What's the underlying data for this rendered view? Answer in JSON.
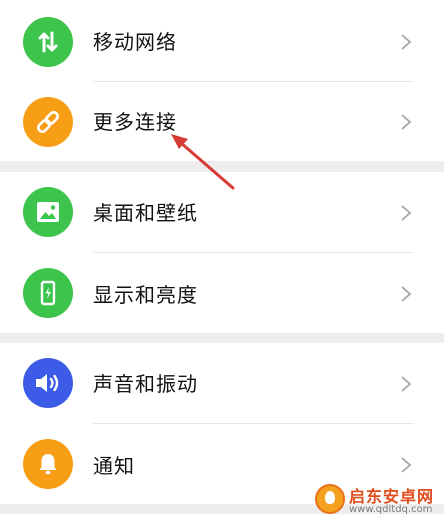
{
  "settings": {
    "items": [
      {
        "label": "移动网络",
        "icon": "data-transfer-icon",
        "color": "#3cc44c"
      },
      {
        "label": "更多连接",
        "icon": "link-icon",
        "color": "#f89e16"
      },
      {
        "label": "桌面和壁纸",
        "icon": "image-icon",
        "color": "#3cc44c"
      },
      {
        "label": "显示和亮度",
        "icon": "phone-brightness-icon",
        "color": "#3cc44c"
      },
      {
        "label": "声音和振动",
        "icon": "speaker-icon",
        "color": "#3c5ce8"
      },
      {
        "label": "通知",
        "icon": "bell-icon",
        "color": "#f89e16"
      }
    ]
  },
  "annotation": {
    "color": "#d83a34",
    "points_to": "更多连接"
  },
  "watermark": {
    "title": "启东安卓网",
    "url": "www.qdltdq.com"
  }
}
